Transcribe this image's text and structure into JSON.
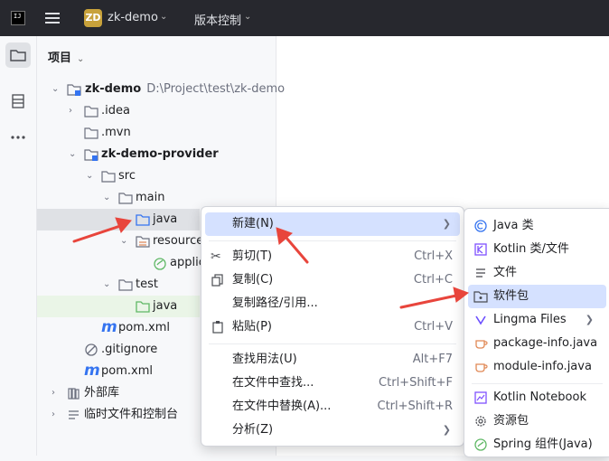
{
  "titlebar": {
    "logo_text": "IJ",
    "project_badge": "ZD",
    "project_name": "zk-demo",
    "vcs_label": "版本控制"
  },
  "panel": {
    "title": "项目"
  },
  "tree": [
    {
      "label": "zk-demo",
      "path": "D:\\Project\\test\\zk-demo"
    },
    {
      "label": ".idea"
    },
    {
      "label": ".mvn"
    },
    {
      "label": "zk-demo-provider"
    },
    {
      "label": "src"
    },
    {
      "label": "main"
    },
    {
      "label": "java"
    },
    {
      "label": "resource"
    },
    {
      "label": "applic"
    },
    {
      "label": "test"
    },
    {
      "label": "java"
    },
    {
      "label": "pom.xml"
    },
    {
      "label": ".gitignore"
    },
    {
      "label": "pom.xml"
    },
    {
      "label": "外部库"
    },
    {
      "label": "临时文件和控制台"
    }
  ],
  "context_menu": {
    "items": [
      {
        "label": "新建(N)",
        "shortcut": ""
      },
      {
        "label": "剪切(T)",
        "shortcut": "Ctrl+X"
      },
      {
        "label": "复制(C)",
        "shortcut": "Ctrl+C"
      },
      {
        "label": "复制路径/引用...",
        "shortcut": ""
      },
      {
        "label": "粘贴(P)",
        "shortcut": "Ctrl+V"
      },
      {
        "label": "查找用法(U)",
        "shortcut": "Alt+F7"
      },
      {
        "label": "在文件中查找...",
        "shortcut": "Ctrl+Shift+F"
      },
      {
        "label": "在文件中替换(A)...",
        "shortcut": "Ctrl+Shift+R"
      },
      {
        "label": "分析(Z)",
        "shortcut": ""
      }
    ]
  },
  "new_submenu": {
    "items": [
      {
        "label": "Java 类"
      },
      {
        "label": "Kotlin 类/文件"
      },
      {
        "label": "文件"
      },
      {
        "label": "软件包"
      },
      {
        "label": "Lingma Files"
      },
      {
        "label": "package-info.java"
      },
      {
        "label": "module-info.java"
      },
      {
        "label": "Kotlin Notebook"
      },
      {
        "label": "资源包"
      },
      {
        "label": "Spring 组件(Java)"
      }
    ]
  },
  "colors": {
    "titlebar_bg": "#27282e",
    "selection": "#d5e1ff",
    "annotation_arrow": "#e8453c",
    "folder_blue": "#3574f0",
    "folder_green": "#5fb865"
  }
}
